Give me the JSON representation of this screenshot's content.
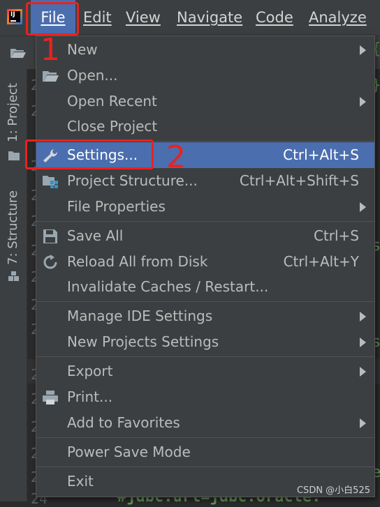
{
  "menubar": {
    "logo_text": "IJ",
    "items": [
      "File",
      "Edit",
      "View",
      "Navigate",
      "Code",
      "Analyze"
    ]
  },
  "sidebar": {
    "project_tab": "1: Project",
    "structure_tab": "7: Structure"
  },
  "editor": {
    "line_numbers": [
      "2",
      "2",
      "2",
      "2",
      "2",
      "2",
      "2",
      "2",
      "2",
      "2",
      "2",
      "2",
      "2",
      "2",
      "24"
    ],
    "bottom_code": "#jdbc.url=jdbc:oracle:",
    "edge_fragments": [
      "{",
      "}",
      "s",
      "s",
      "e"
    ]
  },
  "file_menu": {
    "items": [
      {
        "label": "New",
        "shortcut": "",
        "submenu": true,
        "icon": ""
      },
      {
        "label": "Open...",
        "shortcut": "",
        "submenu": false,
        "icon": "folder-open-icon"
      },
      {
        "label": "Open Recent",
        "shortcut": "",
        "submenu": true,
        "icon": ""
      },
      {
        "label": "Close Project",
        "shortcut": "",
        "submenu": false,
        "icon": ""
      },
      {
        "label": "Settings...",
        "shortcut": "Ctrl+Alt+S",
        "submenu": false,
        "icon": "wrench-icon",
        "selected": true
      },
      {
        "label": "Project Structure...",
        "shortcut": "Ctrl+Alt+Shift+S",
        "submenu": false,
        "icon": "project-structure-icon"
      },
      {
        "label": "File Properties",
        "shortcut": "",
        "submenu": true,
        "icon": ""
      },
      {
        "label": "Save All",
        "shortcut": "Ctrl+S",
        "submenu": false,
        "icon": "save-icon"
      },
      {
        "label": "Reload All from Disk",
        "shortcut": "Ctrl+Alt+Y",
        "submenu": false,
        "icon": "reload-icon"
      },
      {
        "label": "Invalidate Caches / Restart...",
        "shortcut": "",
        "submenu": false,
        "icon": ""
      },
      {
        "label": "Manage IDE Settings",
        "shortcut": "",
        "submenu": true,
        "icon": ""
      },
      {
        "label": "New Projects Settings",
        "shortcut": "",
        "submenu": true,
        "icon": ""
      },
      {
        "label": "Export",
        "shortcut": "",
        "submenu": true,
        "icon": ""
      },
      {
        "label": "Print...",
        "shortcut": "",
        "submenu": false,
        "icon": "printer-icon"
      },
      {
        "label": "Add to Favorites",
        "shortcut": "",
        "submenu": true,
        "icon": ""
      },
      {
        "label": "Power Save Mode",
        "shortcut": "",
        "submenu": false,
        "icon": ""
      },
      {
        "label": "Exit",
        "shortcut": "",
        "submenu": false,
        "icon": ""
      }
    ]
  },
  "annotations": {
    "step1": "1",
    "step2": "2"
  },
  "watermark": "CSDN @小白525",
  "colors": {
    "menubar_bg": "#3c3f41",
    "selection": "#4b6eaf",
    "annotation_red": "#e8231e",
    "code_green": "#629755"
  }
}
